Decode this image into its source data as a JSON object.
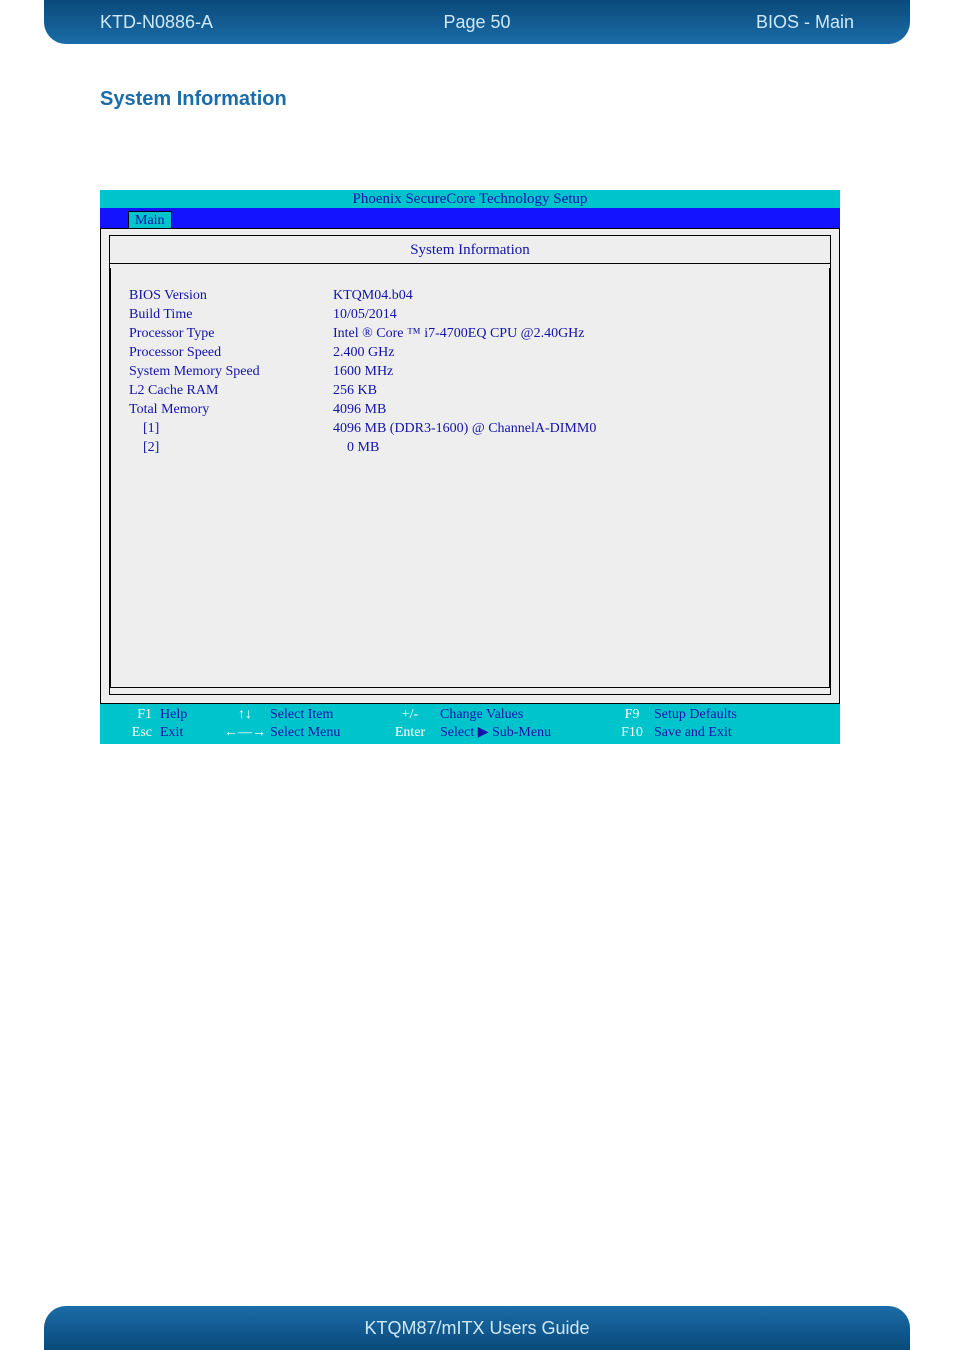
{
  "header": {
    "left": "KTD-N0886-A",
    "center": "Page 50",
    "right": "BIOS  - Main"
  },
  "section_heading": "System Information",
  "bios": {
    "title": "Phoenix SecureCore Technology Setup",
    "tab": "Main",
    "panel_title": "System Information",
    "rows": [
      {
        "label": "BIOS Version",
        "value": "KTQM04.b04"
      },
      {
        "label": "Build Time",
        "value": "10/05/2014"
      },
      {
        "label": "Processor Type",
        "value": "Intel ® Core ™ i7-4700EQ CPU @2.40GHz"
      },
      {
        "label": "Processor Speed",
        "value": "2.400 GHz"
      },
      {
        "label": "System Memory Speed",
        "value": "1600 MHz"
      },
      {
        "label": "L2 Cache RAM",
        "value": "256 KB"
      },
      {
        "label": "Total Memory",
        "value": "4096 MB"
      },
      {
        "label": "[1]",
        "value": "4096 MB (DDR3-1600)    @ ChannelA-DIMM0",
        "indent": true
      },
      {
        "label": "[2]",
        "value": "0 MB",
        "indent": true,
        "valindent": true
      }
    ],
    "footer": {
      "r1": {
        "k1": "F1",
        "a1": "Help",
        "k2": "↑↓",
        "a2": "Select Item",
        "k3": "+/-",
        "a3": "Change Values",
        "k4": "F9",
        "a4": "Setup Defaults"
      },
      "r2": {
        "k1": "Esc",
        "a1": "Exit",
        "k2": "←—→",
        "a2": "Select Menu",
        "k3": "Enter",
        "a3": "Select ▶ Sub-Menu",
        "k4": "F10",
        "a4": "Save and Exit"
      }
    }
  },
  "footer_text": "KTQM87/mITX Users Guide"
}
